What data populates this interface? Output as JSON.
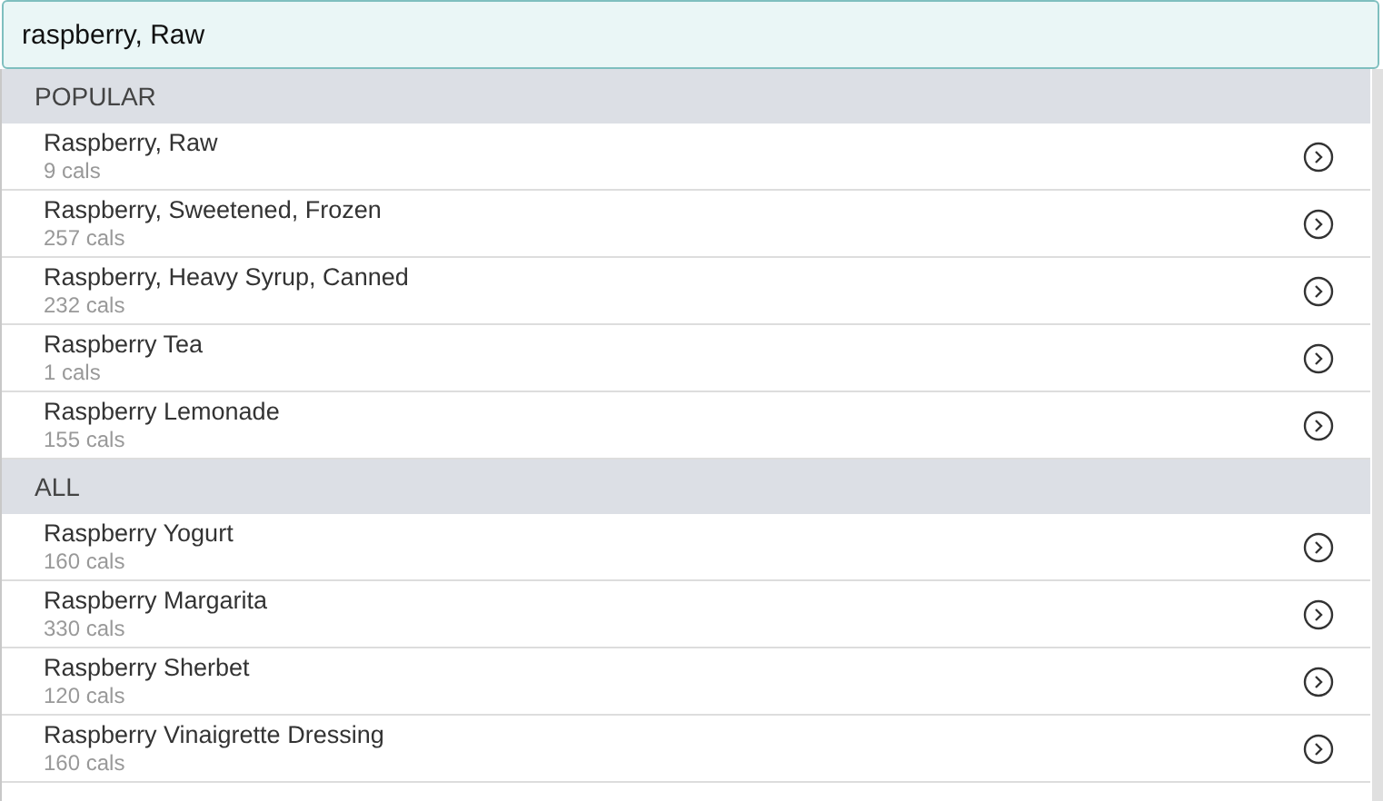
{
  "search": {
    "value": "raspberry, Raw"
  },
  "sections": [
    {
      "title": "POPULAR",
      "items": [
        {
          "name": "Raspberry, Raw",
          "calories": "9 cals"
        },
        {
          "name": "Raspberry, Sweetened, Frozen",
          "calories": "257 cals"
        },
        {
          "name": "Raspberry, Heavy Syrup, Canned",
          "calories": "232 cals"
        },
        {
          "name": "Raspberry Tea",
          "calories": "1 cals"
        },
        {
          "name": "Raspberry Lemonade",
          "calories": "155 cals"
        }
      ]
    },
    {
      "title": "ALL",
      "items": [
        {
          "name": "Raspberry Yogurt",
          "calories": "160 cals"
        },
        {
          "name": "Raspberry Margarita",
          "calories": "330 cals"
        },
        {
          "name": "Raspberry Sherbet",
          "calories": "120 cals"
        },
        {
          "name": "Raspberry Vinaigrette Dressing",
          "calories": "160 cals"
        }
      ]
    }
  ]
}
